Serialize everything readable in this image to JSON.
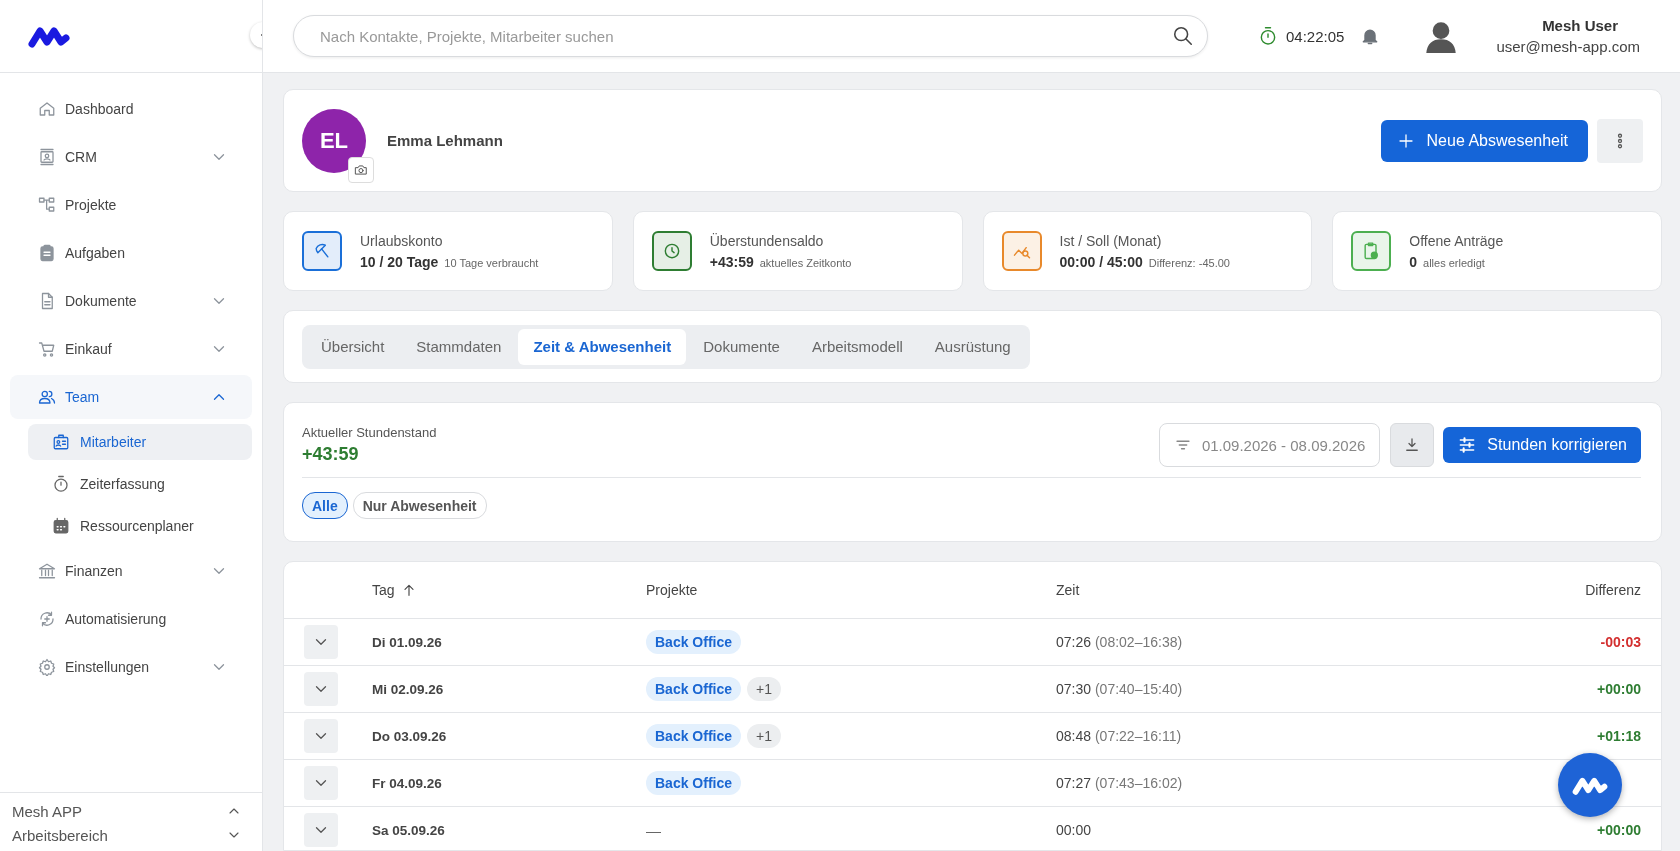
{
  "sidebar": {
    "items": [
      {
        "label": "Dashboard",
        "kind": "link",
        "selected": false
      },
      {
        "label": "CRM",
        "kind": "group",
        "expanded": false,
        "selected": false
      },
      {
        "label": "Projekte",
        "kind": "link",
        "selected": false
      },
      {
        "label": "Aufgaben",
        "kind": "link",
        "selected": false
      },
      {
        "label": "Dokumente",
        "kind": "group",
        "expanded": false,
        "selected": false
      },
      {
        "label": "Einkauf",
        "kind": "group",
        "expanded": false,
        "selected": false
      },
      {
        "label": "Team",
        "kind": "group",
        "expanded": true,
        "selected": true,
        "children": [
          {
            "label": "Mitarbeiter",
            "selected": true
          },
          {
            "label": "Zeiterfassung",
            "selected": false
          },
          {
            "label": "Ressourcenplaner",
            "selected": false
          }
        ]
      },
      {
        "label": "Finanzen",
        "kind": "group",
        "expanded": false,
        "selected": false
      },
      {
        "label": "Automatisierung",
        "kind": "link",
        "selected": false
      },
      {
        "label": "Einstellungen",
        "kind": "group",
        "expanded": false,
        "selected": false
      }
    ],
    "footer": [
      {
        "label": "Mesh APP",
        "expanded": true
      },
      {
        "label": "Arbeitsbereich",
        "expanded": false
      }
    ]
  },
  "header": {
    "search": {
      "placeholder": "Nach Kontakte, Projekte, Mitarbeiter suchen"
    },
    "timer": "04:22:05",
    "user": {
      "name": "Mesh User",
      "email": "user@mesh-app.com"
    }
  },
  "profile": {
    "initials": "EL",
    "name": "Emma Lehmann",
    "primary_action": "Neue Abswesenheit"
  },
  "stats": [
    {
      "title": "Urlaubskonto",
      "value": "10 / 20 Tage",
      "note": "10 Tage verbraucht",
      "color": "#1a6fd8"
    },
    {
      "title": "Überstundensaldo",
      "value": "+43:59",
      "note": "aktuelles Zeitkonto",
      "color": "#2e7d32"
    },
    {
      "title": "Ist / Soll (Monat)",
      "value": "00:00 / 45:00",
      "note": "Differenz: -45.00",
      "color": "#e8892b"
    },
    {
      "title": "Offene Anträge",
      "value": "0",
      "note": "alles erledigt",
      "color": "#4caf50"
    }
  ],
  "tabs": [
    {
      "label": "Übersicht",
      "selected": false
    },
    {
      "label": "Stammdaten",
      "selected": false
    },
    {
      "label": "Zeit & Abwesenheit",
      "selected": true
    },
    {
      "label": "Dokumente",
      "selected": false
    },
    {
      "label": "Arbeitsmodell",
      "selected": false
    },
    {
      "label": "Ausrüstung",
      "selected": false
    }
  ],
  "hours": {
    "label": "Aktueller Stundenstand",
    "value": "+43:59",
    "negative": false,
    "date_range": "01.09.2026 - 08.09.2026",
    "action": "Stunden korrigieren",
    "filters": [
      {
        "label": "Alle",
        "selected": true
      },
      {
        "label": "Nur Abwesenheit",
        "selected": false
      }
    ]
  },
  "table": {
    "columns": [
      {
        "label": "Tag",
        "sorted": true
      },
      {
        "label": "Projekte",
        "sorted": false
      },
      {
        "label": "Zeit",
        "sorted": false
      },
      {
        "label": "Differenz",
        "sorted": false
      }
    ],
    "rows": [
      {
        "expanded": false,
        "day": "Di 01.09.26",
        "projects": [
          "Back Office"
        ],
        "time": "07:26",
        "span": "(08:02–16:38)",
        "diff": "-00:03",
        "negative": true
      },
      {
        "expanded": false,
        "day": "Mi 02.09.26",
        "projects": [
          "Back Office"
        ],
        "more": "+1",
        "time": "07:30",
        "span": "(07:40–15:40)",
        "diff": "+00:00",
        "negative": false
      },
      {
        "expanded": false,
        "day": "Do 03.09.26",
        "projects": [
          "Back Office"
        ],
        "more": "+1",
        "time": "08:48",
        "span": "(07:22–16:11)",
        "diff": "+01:18",
        "negative": false
      },
      {
        "expanded": false,
        "day": "Fr 04.09.26",
        "projects": [
          "Back Office"
        ],
        "time": "07:27",
        "span": "(07:43–16:02)"
      },
      {
        "expanded": false,
        "day": "Sa 05.09.26",
        "projects_text": "—",
        "time": "00:00",
        "diff": "+00:00",
        "negative": false
      }
    ]
  }
}
